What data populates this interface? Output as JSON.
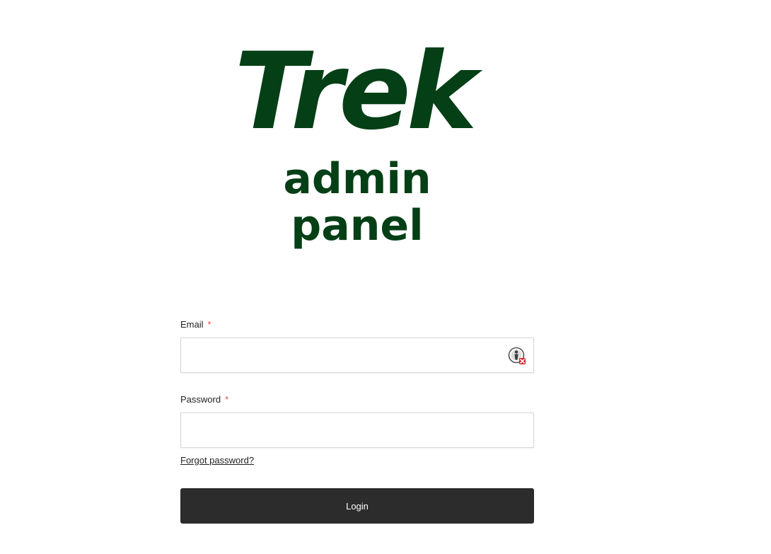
{
  "brand": {
    "title": "Trek",
    "subtitle": "admin panel",
    "color": "#053f16"
  },
  "form": {
    "email": {
      "label": "Email",
      "required_marker": "*",
      "value": "",
      "password_manager_icon": "password-manager-icon"
    },
    "password": {
      "label": "Password",
      "required_marker": "*",
      "value": ""
    },
    "forgot_link": "Forgot password?",
    "login_button": "Login",
    "button_color": "#2c2c2c",
    "required_color": "#e34b4b"
  }
}
